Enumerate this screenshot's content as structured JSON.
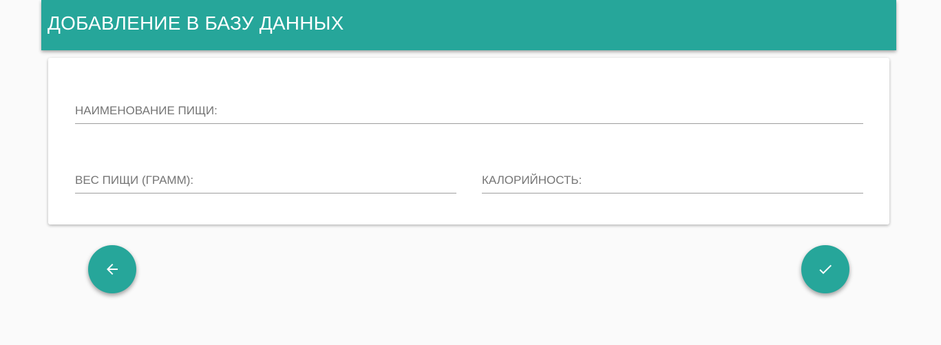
{
  "header": {
    "title": "ДОБАВЛЕНИЕ В БАЗУ ДАННЫХ",
    "background_color": "#26a69a"
  },
  "form": {
    "food_name": {
      "label": "НАИМЕНОВАНИЕ ПИЩИ:",
      "value": ""
    },
    "food_weight": {
      "label": "ВЕС ПИЩИ (ГРАММ):",
      "value": ""
    },
    "calories": {
      "label": "КАЛОРИЙНОСТЬ:",
      "value": ""
    }
  },
  "actions": {
    "back": {
      "icon": "arrow-back-icon"
    },
    "confirm": {
      "icon": "check-icon"
    },
    "accent_color": "#26a69a"
  }
}
